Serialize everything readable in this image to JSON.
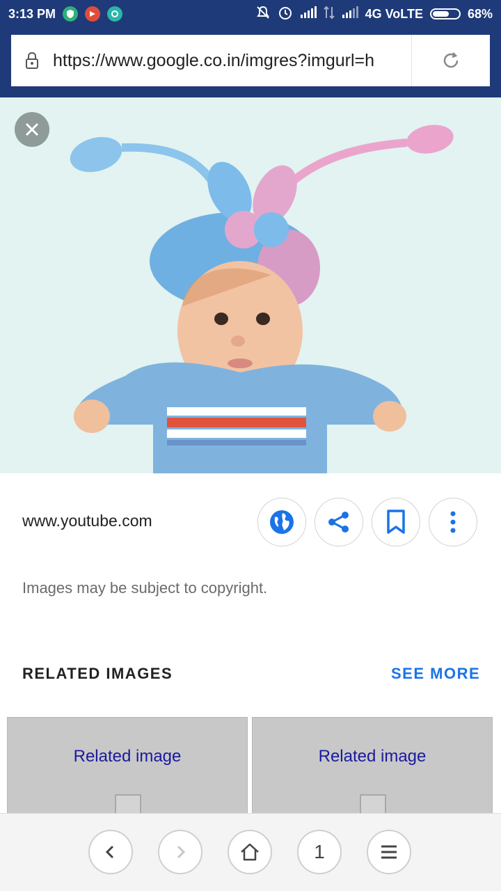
{
  "status_bar": {
    "time": "3:13 PM",
    "network": "4G VoLTE",
    "battery": "68%",
    "battery_level": 0.68
  },
  "browser": {
    "url": "https://www.google.co.in/imgres?imgurl=h"
  },
  "image_view": {
    "source": "www.youtube.com",
    "copyright_notice": "Images may be subject to copyright.",
    "actions": [
      "globe-icon",
      "share-icon",
      "bookmark-icon",
      "more-vert-icon"
    ]
  },
  "related": {
    "title": "RELATED IMAGES",
    "see_more": "SEE MORE",
    "items": [
      {
        "label": "Related image"
      },
      {
        "label": "Related image"
      }
    ]
  },
  "bottom_nav": {
    "tab_count": "1"
  },
  "colors": {
    "status_bar_bg": "#1f3a78",
    "accent": "#1a73e8",
    "link": "#1a1a9e"
  }
}
